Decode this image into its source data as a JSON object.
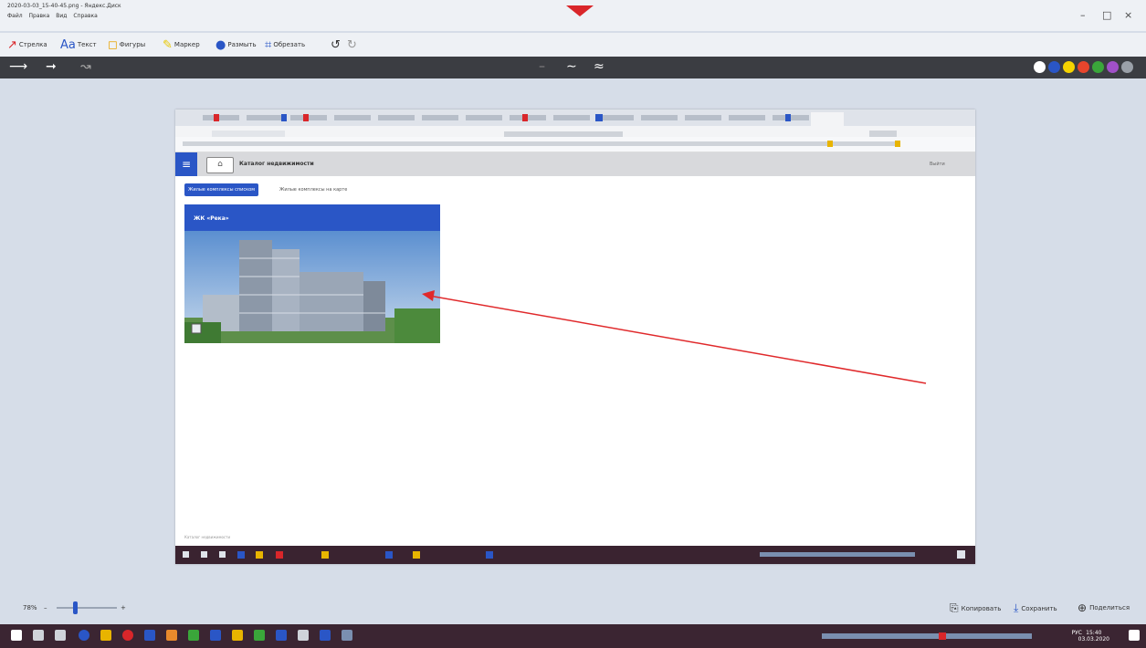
{
  "window": {
    "title": "2020-03-03_15-40-45.png - Яндекс.Диск",
    "menu": [
      "Файл",
      "Правка",
      "Вид",
      "Справка"
    ],
    "controls": {
      "minimize": "–",
      "maximize": "□",
      "close": "×"
    }
  },
  "toolbar": {
    "tools": [
      {
        "label": "Стрелка",
        "icon": "arrow-icon"
      },
      {
        "label": "Текст",
        "icon": "text-icon"
      },
      {
        "label": "Фигуры",
        "icon": "shapes-icon"
      },
      {
        "label": "Маркер",
        "icon": "marker-icon"
      },
      {
        "label": "Размыть",
        "icon": "blur-icon"
      },
      {
        "label": "Обрезать",
        "icon": "crop-icon"
      }
    ]
  },
  "strokebar": {
    "colors": [
      "#ffffff",
      "#2a56c6",
      "#f5d300",
      "#e8452c",
      "#3aa63a",
      "#a050c8",
      "#9aa0a8"
    ]
  },
  "inner_page": {
    "app_title": "Каталог недвижимости",
    "exit_label": "Выйти",
    "tabs": [
      "Жилые комплексы списком",
      "Жилые комплексы на карте"
    ],
    "card_title": "ЖК «Река»",
    "status_text": "Каталог недвижимости"
  },
  "bottom": {
    "zoom": "78%",
    "zoom_minus": "–",
    "zoom_plus": "+",
    "copy_label": "Копировать",
    "save_label": "Сохранить",
    "share_label": "Поделиться"
  },
  "taskbar": {
    "time": "15:40",
    "date": "03.03.2020",
    "lang": "РУС"
  },
  "accent": "#2a56c6",
  "annotation_color": "#e0292b"
}
